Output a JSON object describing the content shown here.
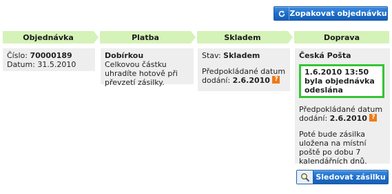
{
  "actions": {
    "reorder_label": "Zopakovat objednávku",
    "track_label": "Sledovat zásilku"
  },
  "steps": [
    {
      "label": "Objednávka"
    },
    {
      "label": "Platba"
    },
    {
      "label": "Skladem"
    },
    {
      "label": "Doprava"
    }
  ],
  "order": {
    "number_label": "Číslo:",
    "number": "70000189",
    "date_label": "Datum:",
    "date": "31.5.2010"
  },
  "payment": {
    "method": "Dobírkou",
    "note": "Celkovou částku uhradíte hotově při převzetí zásilky."
  },
  "stock": {
    "state_label": "Stav:",
    "state": "Skladem",
    "expected_label": "Předpokládané datum dodání:",
    "expected_date": "2.6.2010",
    "help": "?"
  },
  "shipping": {
    "carrier": "Česká Pošta",
    "shipped_notice": "1.6.2010 13:50 byla objednávka odeslána",
    "expected_label": "Předpokládané datum dodání:",
    "expected_date": "2.6.2010",
    "help": "?",
    "storage_note": "Poté bude zásilka uložena na místní poště po dobu 7 kalendářních dnů."
  },
  "colors": {
    "button_blue": "#1d6cc8",
    "step_green": "#d5f2b8",
    "panel_grey": "#eeeeee",
    "notice_border": "#35c435",
    "help_orange": "#ee7a1a"
  }
}
